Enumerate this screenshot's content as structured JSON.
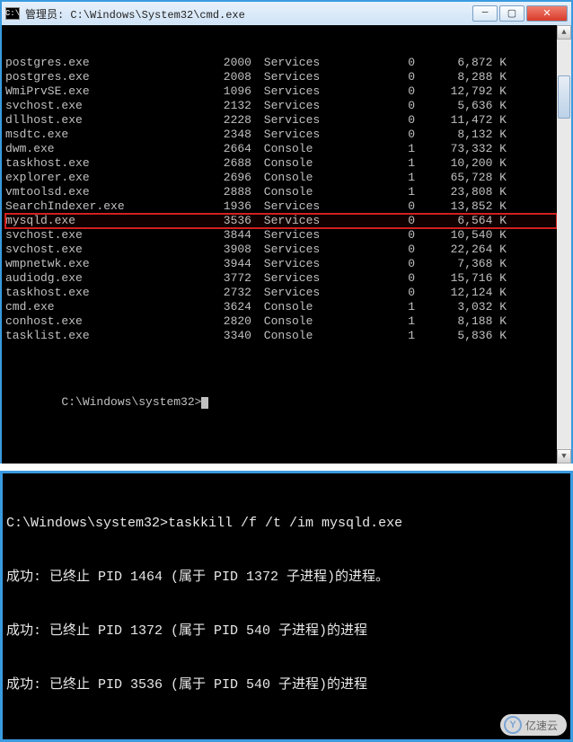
{
  "window": {
    "icon_label": "C:\\",
    "title": "管理员: C:\\Windows\\System32\\cmd.exe",
    "min": "─",
    "max": "▢",
    "close": "✕"
  },
  "scroll": {
    "up": "▲",
    "down": "▼"
  },
  "processes": [
    {
      "name": "postgres.exe",
      "pid": "2000",
      "session": "Services",
      "snum": "0",
      "mem": "6,872 K"
    },
    {
      "name": "postgres.exe",
      "pid": "2008",
      "session": "Services",
      "snum": "0",
      "mem": "8,288 K"
    },
    {
      "name": "WmiPrvSE.exe",
      "pid": "1096",
      "session": "Services",
      "snum": "0",
      "mem": "12,792 K"
    },
    {
      "name": "svchost.exe",
      "pid": "2132",
      "session": "Services",
      "snum": "0",
      "mem": "5,636 K"
    },
    {
      "name": "dllhost.exe",
      "pid": "2228",
      "session": "Services",
      "snum": "0",
      "mem": "11,472 K"
    },
    {
      "name": "msdtc.exe",
      "pid": "2348",
      "session": "Services",
      "snum": "0",
      "mem": "8,132 K"
    },
    {
      "name": "dwm.exe",
      "pid": "2664",
      "session": "Console",
      "snum": "1",
      "mem": "73,332 K"
    },
    {
      "name": "taskhost.exe",
      "pid": "2688",
      "session": "Console",
      "snum": "1",
      "mem": "10,200 K"
    },
    {
      "name": "explorer.exe",
      "pid": "2696",
      "session": "Console",
      "snum": "1",
      "mem": "65,728 K"
    },
    {
      "name": "vmtoolsd.exe",
      "pid": "2888",
      "session": "Console",
      "snum": "1",
      "mem": "23,808 K"
    },
    {
      "name": "SearchIndexer.exe",
      "pid": "1936",
      "session": "Services",
      "snum": "0",
      "mem": "13,852 K"
    },
    {
      "name": "mysqld.exe",
      "pid": "3536",
      "session": "Services",
      "snum": "0",
      "mem": "6,564 K",
      "hl": true
    },
    {
      "name": "svchost.exe",
      "pid": "3844",
      "session": "Services",
      "snum": "0",
      "mem": "10,540 K"
    },
    {
      "name": "svchost.exe",
      "pid": "3908",
      "session": "Services",
      "snum": "0",
      "mem": "22,264 K"
    },
    {
      "name": "wmpnetwk.exe",
      "pid": "3944",
      "session": "Services",
      "snum": "0",
      "mem": "7,368 K"
    },
    {
      "name": "audiodg.exe",
      "pid": "3772",
      "session": "Services",
      "snum": "0",
      "mem": "15,716 K"
    },
    {
      "name": "taskhost.exe",
      "pid": "2732",
      "session": "Services",
      "snum": "0",
      "mem": "12,124 K"
    },
    {
      "name": "cmd.exe",
      "pid": "3624",
      "session": "Console",
      "snum": "1",
      "mem": "3,032 K"
    },
    {
      "name": "conhost.exe",
      "pid": "2820",
      "session": "Console",
      "snum": "1",
      "mem": "8,188 K"
    },
    {
      "name": "tasklist.exe",
      "pid": "3340",
      "session": "Console",
      "snum": "1",
      "mem": "5,836 K"
    }
  ],
  "prompt": "C:\\Windows\\system32>",
  "footer": {
    "cmdline": "C:\\Windows\\system32>taskkill /f /t /im mysqld.exe",
    "lines": [
      "成功: 已终止 PID 1464 (属于 PID 1372 子进程)的进程。",
      "成功: 已终止 PID 1372 (属于 PID 540 子进程)的进程",
      "成功: 已终止 PID 3536 (属于 PID 540 子进程)的进程"
    ]
  },
  "watermark": {
    "icon": "Y",
    "text": "亿速云"
  }
}
